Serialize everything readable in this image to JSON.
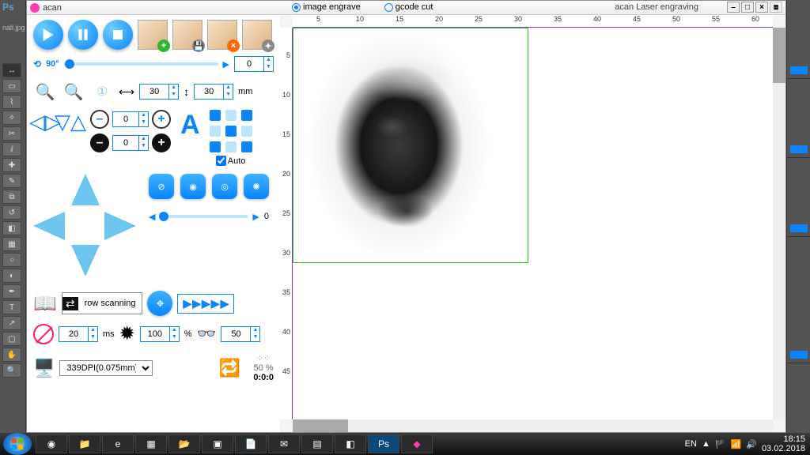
{
  "ps": {
    "logo": "Ps",
    "mini": "nall.jpg"
  },
  "app": {
    "name": "acan",
    "caption": "acan Laser engraving",
    "mode_engrave": "image engrave",
    "mode_gcode": "gcode cut"
  },
  "controls": {
    "angle_label": "90°",
    "angle_value": "0",
    "width_value": "30",
    "height_value": "30",
    "unit_mm": "mm",
    "step_value1": "0",
    "step_value2": "0",
    "auto_label": "Auto",
    "speed_slider": "0",
    "scan_label": "row scanning",
    "ms_value": "20",
    "ms_unit": "ms",
    "pct_value": "100",
    "pct_unit": "%",
    "cut_value": "50",
    "dpi_value": "339DPI(0.075mm)",
    "progress_pct": "50 %",
    "timer": "0:0:0"
  },
  "ruler_h": [
    "5",
    "10",
    "15",
    "20",
    "25",
    "30",
    "35",
    "40",
    "45",
    "50",
    "55",
    "60"
  ],
  "ruler_v": [
    "5",
    "10",
    "15",
    "20",
    "25",
    "30",
    "35",
    "40",
    "45"
  ],
  "taskbar": {
    "lang": "EN",
    "time": "18:15",
    "date": "03.02.2018"
  }
}
